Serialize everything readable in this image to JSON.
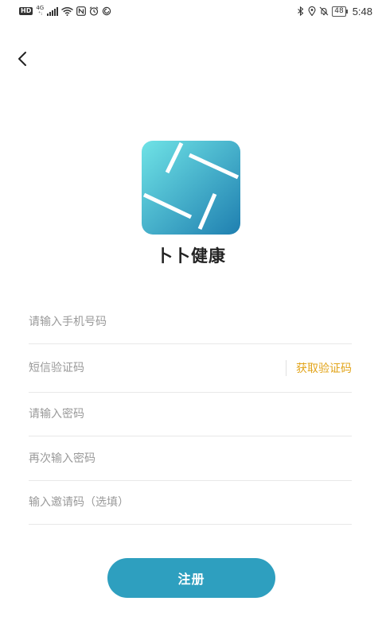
{
  "status_bar": {
    "left_icons": [
      "hd-badge",
      "signal-4g-icon",
      "signal-bars-icon",
      "wifi-icon",
      "nfc-icon",
      "alarm-icon",
      "app-notification-icon"
    ],
    "hd_label": "HD",
    "net_label_top": "4G",
    "net_label_bottom": "⁺ᵢ",
    "right_icons": [
      "bluetooth-icon",
      "location-icon",
      "mute-icon"
    ],
    "battery": "48",
    "time": "5:48"
  },
  "app": {
    "name": "卜卜健康",
    "logo_colors": {
      "top_left": "#6fe3e6",
      "bottom_right": "#1f7fb0"
    }
  },
  "form": {
    "phone": {
      "value": "",
      "placeholder": "请输入手机号码"
    },
    "code": {
      "value": "",
      "placeholder": "短信验证码",
      "get_code_label": "获取验证码"
    },
    "password": {
      "value": "",
      "placeholder": "请输入密码"
    },
    "password_confirm": {
      "value": "",
      "placeholder": "再次输入密码"
    },
    "invite": {
      "value": "",
      "placeholder": "输入邀请码（选填）"
    }
  },
  "actions": {
    "register_label": "注册",
    "accent_color": "#2e9fbf",
    "link_color": "#e2a41a"
  }
}
